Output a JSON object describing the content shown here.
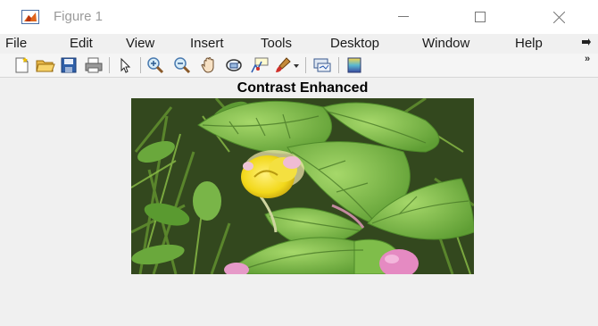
{
  "window": {
    "title": "Figure 1",
    "icon": "matlab-figure-icon",
    "controls": [
      "minimize-icon",
      "maximize-icon",
      "close-icon"
    ]
  },
  "menu": {
    "items": [
      "File",
      "Edit",
      "View",
      "Insert",
      "Tools",
      "Desktop",
      "Window",
      "Help"
    ],
    "overflow": "overflow-arrow-icon"
  },
  "toolbar": {
    "icons": [
      "new-figure-icon",
      "open-file-icon",
      "save-icon",
      "print-icon",
      "edit-plot-pointer-icon",
      "zoom-in-icon",
      "zoom-out-icon",
      "pan-hand-icon",
      "rotate-3d-icon",
      "data-cursor-icon",
      "brush-icon",
      "brush-dropdown-icon",
      "link-plot-icon",
      "colorbar-icon"
    ],
    "overflow": "»"
  },
  "figure": {
    "axes_title": "Contrast Enhanced",
    "image_subject": "green leaves with a yellow flower and pink bud"
  },
  "colors": {
    "background": "#f0f0f0",
    "titlebar": "#ffffff",
    "leaf": "#7cc04a",
    "flower": "#f2e21c"
  }
}
